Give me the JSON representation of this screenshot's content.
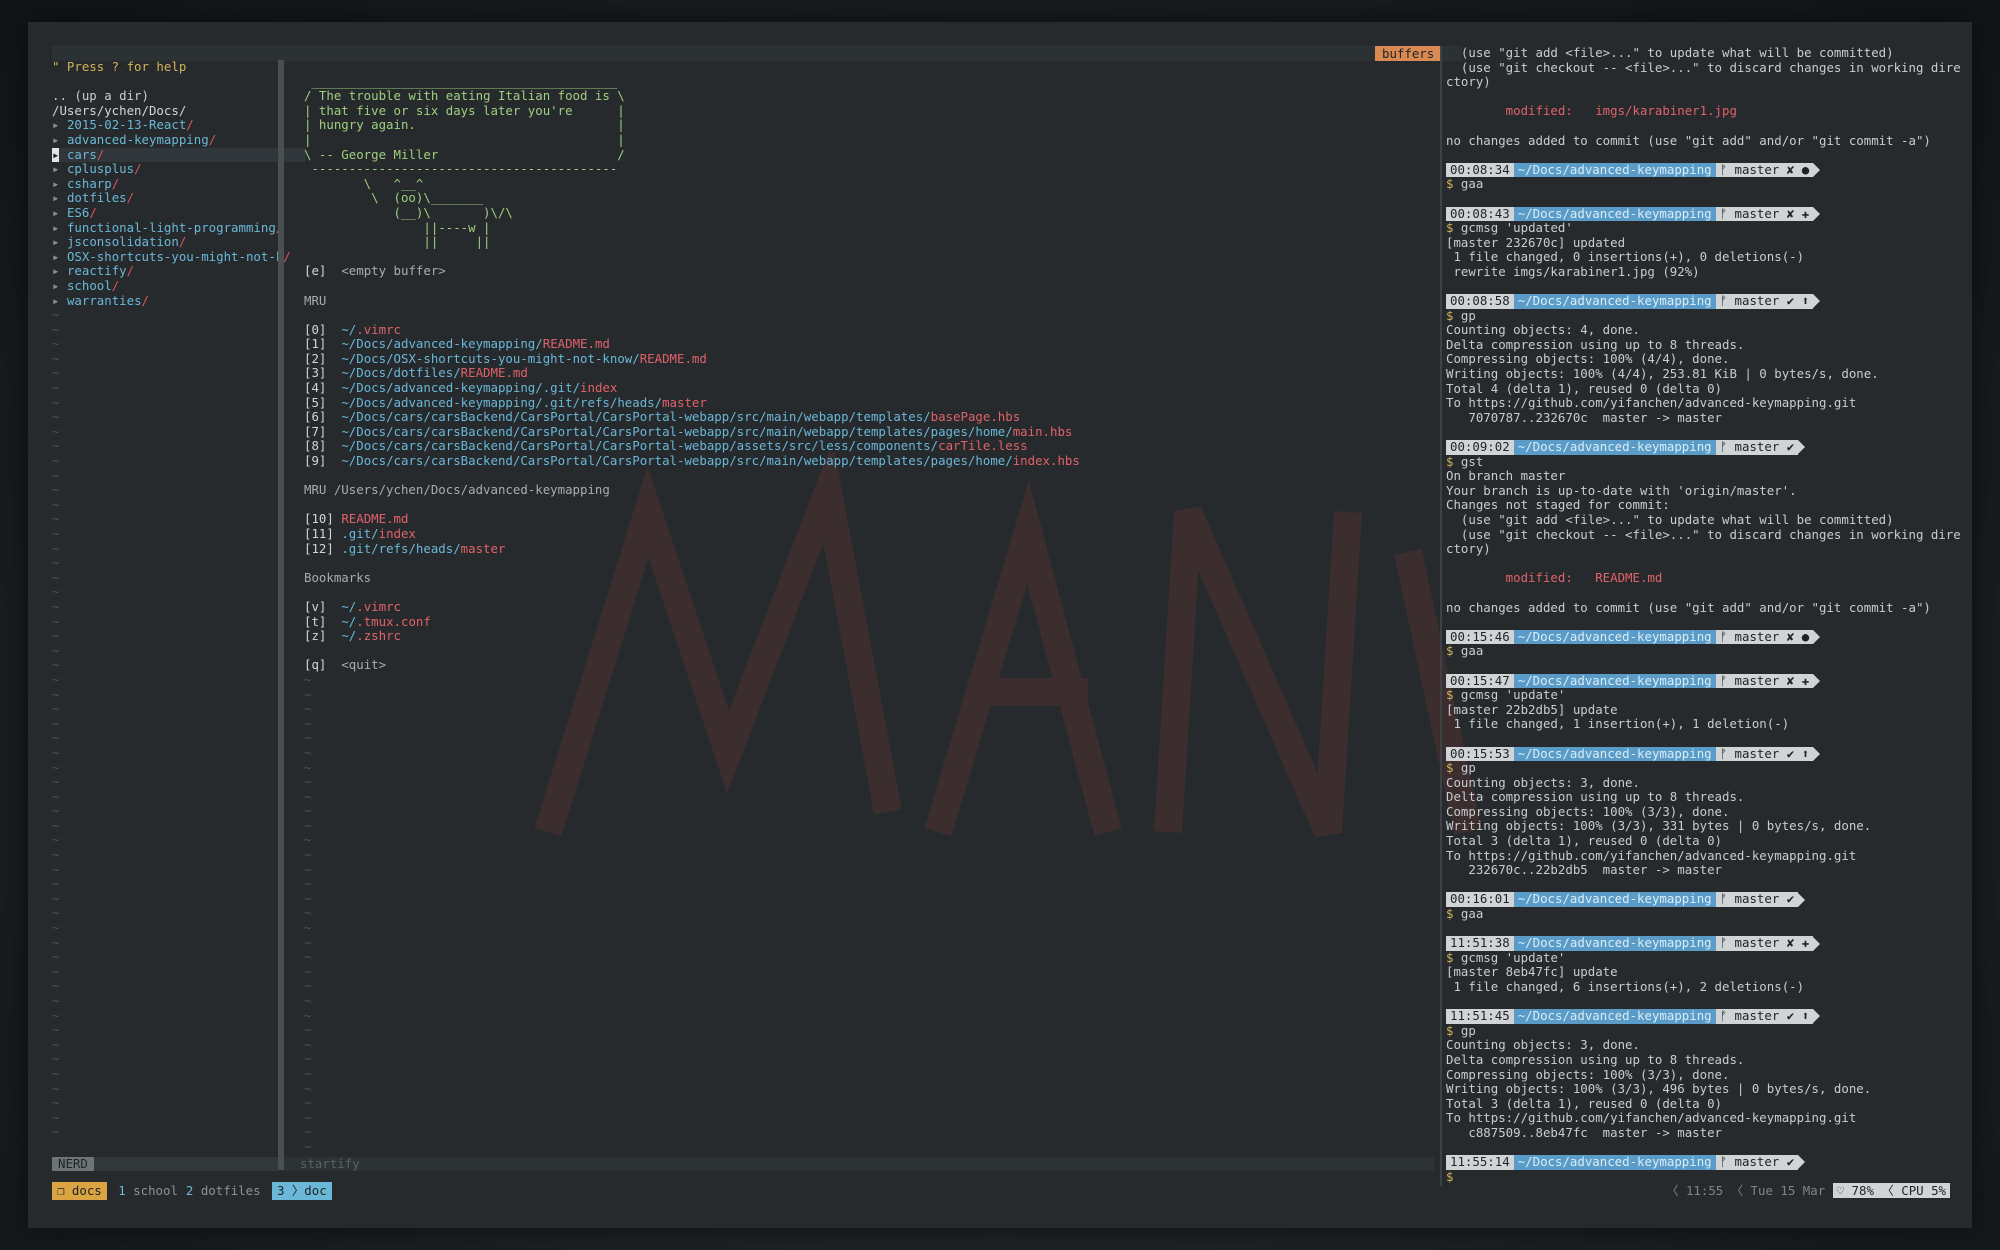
{
  "nerdtree": {
    "help": "\" Press ? for help",
    "up": ".. (up a dir)",
    "root": "/Users/ychen/Docs/",
    "items": [
      {
        "name": "2015-02-13-React"
      },
      {
        "name": "advanced-keymapping"
      },
      {
        "name": "cars"
      },
      {
        "name": "cplusplus"
      },
      {
        "name": "csharp"
      },
      {
        "name": "dotfiles"
      },
      {
        "name": "ES6"
      },
      {
        "name": "functional-light-programming"
      },
      {
        "name": "jsconsolidation"
      },
      {
        "name": "OSX-shortcuts-you-might-not-k"
      },
      {
        "name": "reactify"
      },
      {
        "name": "school"
      },
      {
        "name": "warranties"
      }
    ],
    "selected_index": 2,
    "status_label": "NERD"
  },
  "startify": {
    "tab_label": "buffers",
    "status_label": "startify",
    "cowsay": [
      " _________________________________________",
      "/ The trouble with eating Italian food is \\",
      "| that five or six days later you're      |",
      "| hungry again.                           |",
      "|                                         |",
      "\\ -- George Miller                        /",
      " -----------------------------------------",
      "        \\   ^__^",
      "         \\  (oo)\\_______",
      "            (__)\\       )\\/\\",
      "                ||----w |",
      "                ||     ||"
    ],
    "empty_key": "[e]",
    "empty_label": "<empty buffer>",
    "mru_title": "MRU",
    "mru": [
      {
        "key": "[0]",
        "dir": "~/",
        "file": ".vimrc"
      },
      {
        "key": "[1]",
        "dir": "~/Docs/advanced-keymapping/",
        "file": "README.md"
      },
      {
        "key": "[2]",
        "dir": "~/Docs/OSX-shortcuts-you-might-not-know/",
        "file": "README.md"
      },
      {
        "key": "[3]",
        "dir": "~/Docs/dotfiles/",
        "file": "README.md"
      },
      {
        "key": "[4]",
        "dir": "~/Docs/advanced-keymapping/.git/",
        "file": "index"
      },
      {
        "key": "[5]",
        "dir": "~/Docs/advanced-keymapping/.git/refs/heads/",
        "file": "master"
      },
      {
        "key": "[6]",
        "dir": "~/Docs/cars/carsBackend/CarsPortal/CarsPortal-webapp/src/main/webapp/templates/",
        "file": "basePage.hbs"
      },
      {
        "key": "[7]",
        "dir": "~/Docs/cars/carsBackend/CarsPortal/CarsPortal-webapp/src/main/webapp/templates/pages/home/",
        "file": "main.hbs"
      },
      {
        "key": "[8]",
        "dir": "~/Docs/cars/carsBackend/CarsPortal/CarsPortal-webapp/assets/src/less/components/",
        "file": "carTile.less"
      },
      {
        "key": "[9]",
        "dir": "~/Docs/cars/carsBackend/CarsPortal/CarsPortal-webapp/src/main/webapp/templates/pages/home/",
        "file": "index.hbs"
      }
    ],
    "mru_dir_title": "MRU /Users/ychen/Docs/advanced-keymapping",
    "mru_dir": [
      {
        "key": "[10]",
        "dir": "",
        "file": "README.md"
      },
      {
        "key": "[11]",
        "dir": ".git/",
        "file": "index"
      },
      {
        "key": "[12]",
        "dir": ".git/refs/heads/",
        "file": "master"
      }
    ],
    "bookmarks_title": "Bookmarks",
    "bookmarks": [
      {
        "key": "[v]",
        "dir": "~/",
        "file": ".vimrc"
      },
      {
        "key": "[t]",
        "dir": "~/",
        "file": ".tmux.conf"
      },
      {
        "key": "[z]",
        "dir": "~/",
        "file": ".zshrc"
      }
    ],
    "quit_key": "[q]",
    "quit_label": "<quit>"
  },
  "shell": {
    "lines": [
      {
        "t": "text",
        "v": "  (use \"git add <file>...\" to update what will be committed)"
      },
      {
        "t": "text",
        "v": "  (use \"git checkout -- <file>...\" to discard changes in working dire"
      },
      {
        "t": "text",
        "v": "ctory)"
      },
      {
        "t": "blank"
      },
      {
        "t": "mod",
        "v": "        modified:   imgs/karabiner1.jpg"
      },
      {
        "t": "blank"
      },
      {
        "t": "text",
        "v": "no changes added to commit (use \"git add\" and/or \"git commit -a\")"
      },
      {
        "t": "blank"
      },
      {
        "t": "prompt",
        "time": "00:08:34",
        "dir": "~/Docs/advanced-keymapping",
        "git": "ᚠ master ✘ ●"
      },
      {
        "t": "cmd",
        "v": "gaa"
      },
      {
        "t": "blank"
      },
      {
        "t": "prompt",
        "time": "00:08:43",
        "dir": "~/Docs/advanced-keymapping",
        "git": "ᚠ master ✘ ✚"
      },
      {
        "t": "cmd",
        "v": "gcmsg 'updated'"
      },
      {
        "t": "text",
        "v": "[master 232670c] updated"
      },
      {
        "t": "text",
        "v": " 1 file changed, 0 insertions(+), 0 deletions(-)"
      },
      {
        "t": "text",
        "v": " rewrite imgs/karabiner1.jpg (92%)"
      },
      {
        "t": "blank"
      },
      {
        "t": "prompt",
        "time": "00:08:58",
        "dir": "~/Docs/advanced-keymapping",
        "git": "ᚠ master ✔ ⬆"
      },
      {
        "t": "cmd",
        "v": "gp"
      },
      {
        "t": "text",
        "v": "Counting objects: 4, done."
      },
      {
        "t": "text",
        "v": "Delta compression using up to 8 threads."
      },
      {
        "t": "text",
        "v": "Compressing objects: 100% (4/4), done."
      },
      {
        "t": "text",
        "v": "Writing objects: 100% (4/4), 253.81 KiB | 0 bytes/s, done."
      },
      {
        "t": "text",
        "v": "Total 4 (delta 1), reused 0 (delta 0)"
      },
      {
        "t": "text",
        "v": "To https://github.com/yifanchen/advanced-keymapping.git"
      },
      {
        "t": "text",
        "v": "   7070787..232670c  master -> master"
      },
      {
        "t": "blank"
      },
      {
        "t": "prompt",
        "time": "00:09:02",
        "dir": "~/Docs/advanced-keymapping",
        "git": "ᚠ master ✔"
      },
      {
        "t": "cmd",
        "v": "gst"
      },
      {
        "t": "text",
        "v": "On branch master"
      },
      {
        "t": "text",
        "v": "Your branch is up-to-date with 'origin/master'."
      },
      {
        "t": "text",
        "v": "Changes not staged for commit:"
      },
      {
        "t": "text",
        "v": "  (use \"git add <file>...\" to update what will be committed)"
      },
      {
        "t": "text",
        "v": "  (use \"git checkout -- <file>...\" to discard changes in working dire"
      },
      {
        "t": "text",
        "v": "ctory)"
      },
      {
        "t": "blank"
      },
      {
        "t": "mod",
        "v": "        modified:   README.md"
      },
      {
        "t": "blank"
      },
      {
        "t": "text",
        "v": "no changes added to commit (use \"git add\" and/or \"git commit -a\")"
      },
      {
        "t": "blank"
      },
      {
        "t": "prompt",
        "time": "00:15:46",
        "dir": "~/Docs/advanced-keymapping",
        "git": "ᚠ master ✘ ●"
      },
      {
        "t": "cmd",
        "v": "gaa"
      },
      {
        "t": "blank"
      },
      {
        "t": "prompt",
        "time": "00:15:47",
        "dir": "~/Docs/advanced-keymapping",
        "git": "ᚠ master ✘ ✚"
      },
      {
        "t": "cmd",
        "v": "gcmsg 'update'"
      },
      {
        "t": "text",
        "v": "[master 22b2db5] update"
      },
      {
        "t": "text",
        "v": " 1 file changed, 1 insertion(+), 1 deletion(-)"
      },
      {
        "t": "blank"
      },
      {
        "t": "prompt",
        "time": "00:15:53",
        "dir": "~/Docs/advanced-keymapping",
        "git": "ᚠ master ✔ ⬆"
      },
      {
        "t": "cmd",
        "v": "gp"
      },
      {
        "t": "text",
        "v": "Counting objects: 3, done."
      },
      {
        "t": "text",
        "v": "Delta compression using up to 8 threads."
      },
      {
        "t": "text",
        "v": "Compressing objects: 100% (3/3), done."
      },
      {
        "t": "text",
        "v": "Writing objects: 100% (3/3), 331 bytes | 0 bytes/s, done."
      },
      {
        "t": "text",
        "v": "Total 3 (delta 1), reused 0 (delta 0)"
      },
      {
        "t": "text",
        "v": "To https://github.com/yifanchen/advanced-keymapping.git"
      },
      {
        "t": "text",
        "v": "   232670c..22b2db5  master -> master"
      },
      {
        "t": "blank"
      },
      {
        "t": "prompt",
        "time": "00:16:01",
        "dir": "~/Docs/advanced-keymapping",
        "git": "ᚠ master ✔"
      },
      {
        "t": "cmd",
        "v": "gaa"
      },
      {
        "t": "blank"
      },
      {
        "t": "prompt",
        "time": "11:51:38",
        "dir": "~/Docs/advanced-keymapping",
        "git": "ᚠ master ✘ ✚"
      },
      {
        "t": "cmd",
        "v": "gcmsg 'update'"
      },
      {
        "t": "text",
        "v": "[master 8eb47fc] update"
      },
      {
        "t": "text",
        "v": " 1 file changed, 6 insertions(+), 2 deletions(-)"
      },
      {
        "t": "blank"
      },
      {
        "t": "prompt",
        "time": "11:51:45",
        "dir": "~/Docs/advanced-keymapping",
        "git": "ᚠ master ✔ ⬆"
      },
      {
        "t": "cmd",
        "v": "gp"
      },
      {
        "t": "text",
        "v": "Counting objects: 3, done."
      },
      {
        "t": "text",
        "v": "Delta compression using up to 8 threads."
      },
      {
        "t": "text",
        "v": "Compressing objects: 100% (3/3), done."
      },
      {
        "t": "text",
        "v": "Writing objects: 100% (3/3), 496 bytes | 0 bytes/s, done."
      },
      {
        "t": "text",
        "v": "Total 3 (delta 1), reused 0 (delta 0)"
      },
      {
        "t": "text",
        "v": "To https://github.com/yifanchen/advanced-keymapping.git"
      },
      {
        "t": "text",
        "v": "   c887509..8eb47fc  master -> master"
      },
      {
        "t": "blank"
      },
      {
        "t": "prompt",
        "time": "11:55:14",
        "dir": "~/Docs/advanced-keymapping",
        "git": "ᚠ master ✔"
      },
      {
        "t": "cmd",
        "v": ""
      }
    ]
  },
  "tmux": {
    "session": "❐ docs",
    "windows": [
      {
        "num": "1",
        "name": "school"
      },
      {
        "num": "2",
        "name": "dotfiles"
      }
    ],
    "current": "3 〉doc",
    "time": "〈 11:55 〈 Tue 15 Mar",
    "battery": "♡ 78% 〈 CPU 5%"
  },
  "colors": {
    "path": "#6ab7d8",
    "file": "#e0626a",
    "cowsay": "#9fcf7f",
    "prompt_dir_bg": "#5a9cc7",
    "tmux_session": "#d9a441"
  }
}
